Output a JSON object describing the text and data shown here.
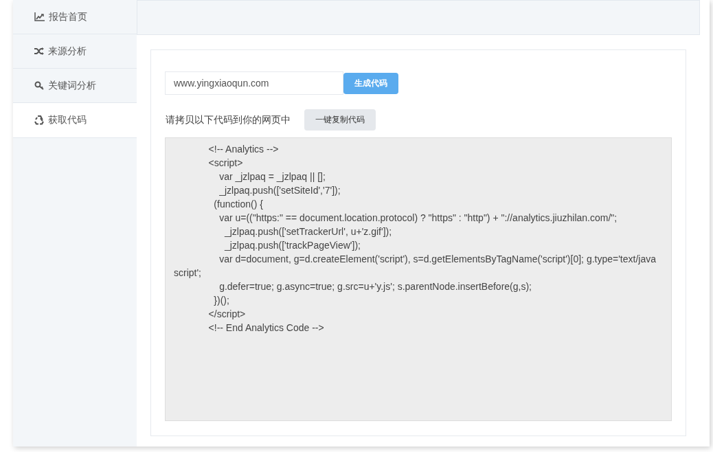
{
  "sidebar": {
    "items": [
      {
        "label": "报告首页",
        "selected": false
      },
      {
        "label": "来源分析",
        "selected": false
      },
      {
        "label": "关键词分析",
        "selected": false
      },
      {
        "label": "获取代码",
        "selected": true
      }
    ]
  },
  "generator": {
    "url_value": "www.yingxiaoqun.com",
    "generate_button": "生成代码"
  },
  "copy": {
    "instruction": "请拷贝以下代码到你的网页中",
    "copy_button": "一键复制代码"
  },
  "code": "             <!-- Analytics -->\n             <script>\n                 var _jzlpaq = _jzlpaq || [];\n                 _jzlpaq.push(['setSiteId','7']);\n               (function() {\n                 var u=((\"https:\" == document.location.protocol) ? \"https\" : \"http\") + \"://analytics.jiuzhilan.com/\";\n                   _jzlpaq.push(['setTrackerUrl', u+'z.gif']);\n                   _jzlpaq.push(['trackPageView']);\n                 var d=document, g=d.createElement('script'), s=d.getElementsByTagName('script')[0]; g.type='text/javascript';\n                 g.defer=true; g.async=true; g.src=u+'y.js'; s.parentNode.insertBefore(g,s);\n               })();\n             </script>\n             <!-- End Analytics Code -->"
}
